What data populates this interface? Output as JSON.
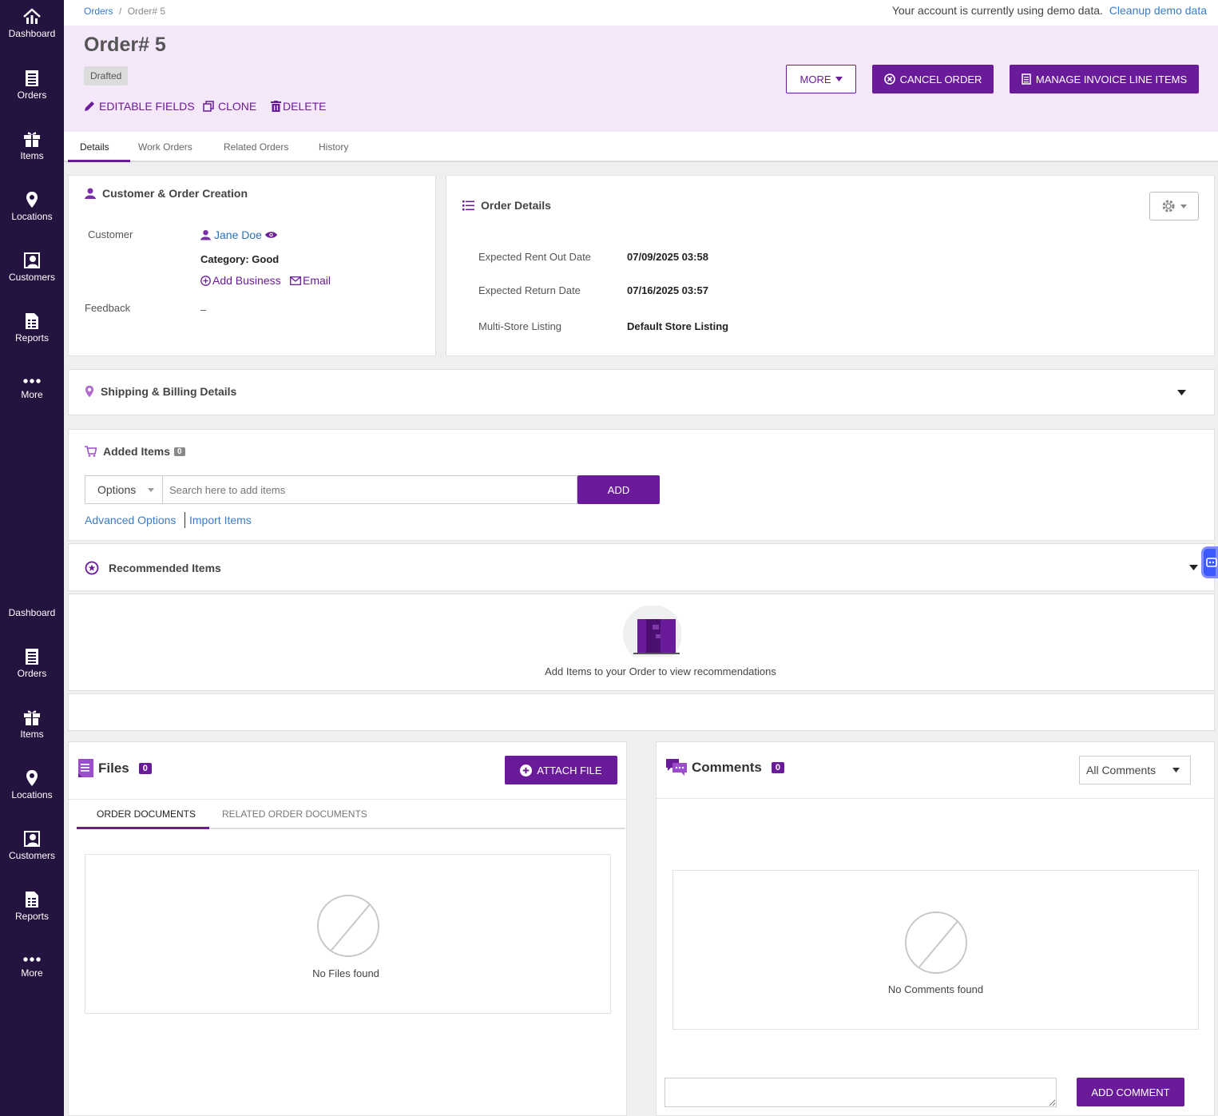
{
  "sidebar": {
    "items": [
      {
        "label": "Dashboard",
        "icon": "dashboard-icon"
      },
      {
        "label": "Orders",
        "icon": "orders-icon"
      },
      {
        "label": "Items",
        "icon": "items-icon"
      },
      {
        "label": "Locations",
        "icon": "location-pin-icon"
      },
      {
        "label": "Customers",
        "icon": "customers-icon"
      },
      {
        "label": "Reports",
        "icon": "reports-icon"
      },
      {
        "label": "More",
        "icon": "more-dots-icon"
      }
    ]
  },
  "breadcrumb": {
    "root": "Orders",
    "separator": "/",
    "current": "Order# 5"
  },
  "demo_notice": {
    "text": "Your account is currently using demo data.",
    "link": "Cleanup demo data"
  },
  "header": {
    "title": "Order# 5",
    "status": "Drafted",
    "actions": {
      "editable": "EDITABLE FIELDS",
      "clone": "CLONE",
      "delete": "DELETE"
    },
    "buttons": {
      "more": "MORE",
      "cancel": "CANCEL ORDER",
      "manage": "MANAGE INVOICE LINE ITEMS"
    }
  },
  "tabs": [
    "Details",
    "Work Orders",
    "Related Orders",
    "History"
  ],
  "customer_panel": {
    "title": "Customer & Order Creation",
    "customer_label": "Customer",
    "customer_name": "Jane Doe",
    "category": "Category: Good",
    "add_business": "Add Business",
    "email": "Email",
    "feedback_label": "Feedback",
    "feedback_value": "–"
  },
  "order_details": {
    "title": "Order Details",
    "rows": [
      {
        "label": "Expected Rent Out Date",
        "value": "07/09/2025 03:58"
      },
      {
        "label": "Expected Return Date",
        "value": "07/16/2025 03:57"
      },
      {
        "label": "Multi-Store Listing",
        "value": "Default Store Listing"
      }
    ]
  },
  "shipping": {
    "title": "Shipping & Billing Details"
  },
  "added_items": {
    "title": "Added Items",
    "count": "0",
    "options_label": "Options",
    "search_placeholder": "Search here to add items",
    "add_button": "ADD",
    "advanced_options": "Advanced Options",
    "import_items": "Import Items"
  },
  "recommended": {
    "title": "Recommended Items",
    "empty_text": "Add Items to your Order to view recommendations"
  },
  "files": {
    "title": "Files",
    "count": "0",
    "attach": "ATTACH FILE",
    "tabs": [
      "ORDER DOCUMENTS",
      "RELATED ORDER DOCUMENTS"
    ],
    "empty": "No Files found"
  },
  "comments": {
    "title": "Comments",
    "count": "0",
    "filter": "All Comments",
    "empty": "No Comments found",
    "add_button": "ADD COMMENT"
  },
  "colors": {
    "primary": "#6a1b9a",
    "sidebar": "#24123f",
    "header_bg": "#f6e8fb",
    "link": "#3a7bc8"
  }
}
